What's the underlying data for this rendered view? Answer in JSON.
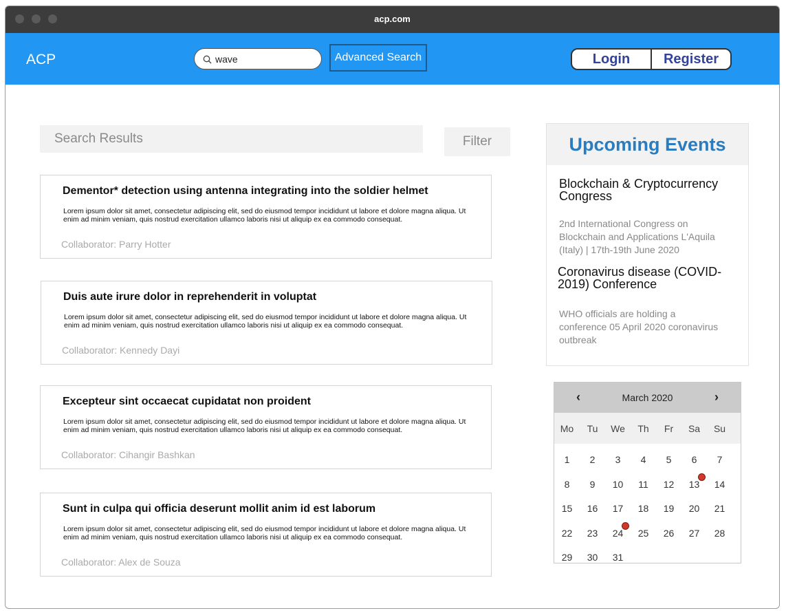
{
  "browser": {
    "url": "acp.com"
  },
  "header": {
    "brand": "ACP",
    "search_value": "wave",
    "advanced_search_label": "Advanced Search",
    "login_label": "Login",
    "register_label": "Register"
  },
  "results": {
    "heading": "Search Results",
    "filter_label": "Filter",
    "items": [
      {
        "title": "Dementor* detection using antenna integrating into the soldier helmet",
        "body": "Lorem ipsum dolor sit amet, consectetur adipiscing elit, sed do eiusmod tempor incididunt ut labore et dolore magna aliqua. Ut enim ad minim veniam, quis nostrud exercitation ullamco laboris nisi ut aliquip ex ea commodo consequat.",
        "collaborator": "Collaborator: Parry Hotter"
      },
      {
        "title": "Duis aute irure dolor in reprehenderit in voluptat",
        "body": "Lorem ipsum dolor sit amet, consectetur adipiscing elit, sed do eiusmod tempor incididunt ut labore et dolore magna aliqua. Ut enim ad minim veniam, quis nostrud exercitation ullamco laboris nisi ut aliquip ex ea commodo consequat.",
        "collaborator": "Collaborator: Kennedy Dayi"
      },
      {
        "title": "Excepteur sint occaecat cupidatat non proident",
        "body": "Lorem ipsum dolor sit amet, consectetur adipiscing elit, sed do eiusmod tempor incididunt ut labore et dolore magna aliqua. Ut enim ad minim veniam, quis nostrud exercitation ullamco laboris nisi ut aliquip ex ea commodo consequat.",
        "collaborator": "Collaborator: Cihangir Bashkan"
      },
      {
        "title": "Sunt in culpa qui officia deserunt mollit anim id est laborum",
        "body": "Lorem ipsum dolor sit amet, consectetur adipiscing elit, sed do eiusmod tempor incididunt ut labore et dolore magna aliqua. Ut enim ad minim veniam, quis nostrud exercitation ullamco laboris nisi ut aliquip ex ea commodo consequat.",
        "collaborator": "Collaborator: Alex de Souza"
      }
    ]
  },
  "events": {
    "heading": "Upcoming Events",
    "items": [
      {
        "title": "Blockchain & Cryptocurrency Congress",
        "desc": "2nd International Congress on Blockchain and Applications L'Aquila (Italy) | 17th-19th June 2020"
      },
      {
        "title": "Coronavirus disease (COVID-2019) Conference",
        "desc": "WHO officials are holding a conference 05 April 2020 coronavirus outbreak"
      }
    ]
  },
  "calendar": {
    "month_label": "March 2020",
    "prev_symbol": "‹",
    "next_symbol": "›",
    "weekdays": [
      "Mo",
      "Tu",
      "We",
      "Th",
      "Fr",
      "Sa",
      "Su"
    ],
    "days": [
      "1",
      "2",
      "3",
      "4",
      "5",
      "6",
      "7",
      "8",
      "9",
      "10",
      "11",
      "12",
      "13",
      "14",
      "15",
      "16",
      "17",
      "18",
      "19",
      "20",
      "21",
      "22",
      "23",
      "24",
      "25",
      "26",
      "27",
      "28",
      "29",
      "30",
      "31"
    ],
    "first_day_column": 0,
    "event_days": [
      "13",
      "24"
    ],
    "event_marker_color": "#d03a2a"
  },
  "colors": {
    "nav_bg": "#2196f3",
    "events_heading": "#2a7cbf",
    "auth_text": "#34439a"
  }
}
